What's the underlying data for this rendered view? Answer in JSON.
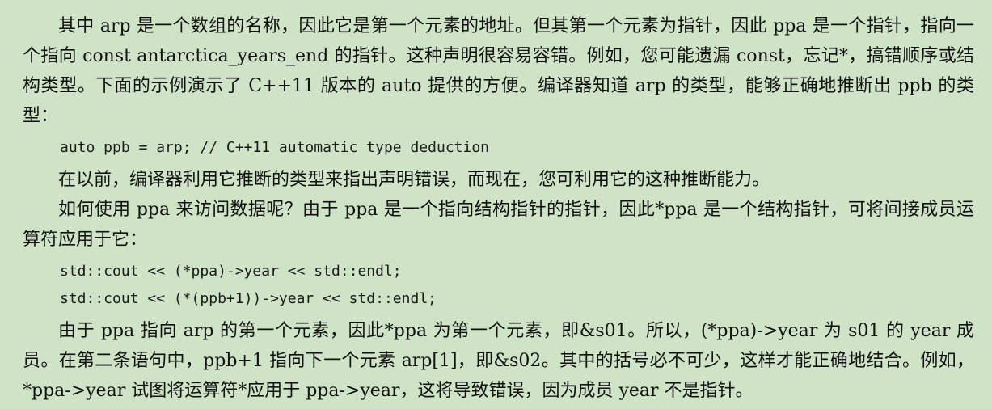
{
  "paragraphs": {
    "p1": "其中 arp 是一个数组的名称，因此它是第一个元素的地址。但其第一个元素为指针，因此 ppa 是一个指针，指向一个指向 const antarctica_years_end 的指针。这种声明很容易容错。例如，您可能遗漏 const，忘记*，搞错顺序或结构类型。下面的示例演示了 C++11 版本的 auto 提供的方便。编译器知道 arp 的类型，能够正确地推断出 ppb 的类型：",
    "code1": "auto ppb = arp; // C++11 automatic type deduction",
    "p2": "在以前，编译器利用它推断的类型来指出声明错误，而现在，您可利用它的这种推断能力。",
    "p3": "如何使用 ppa 来访问数据呢？由于 ppa 是一个指向结构指针的指针，因此*ppa 是一个结构指针，可将间接成员运算符应用于它：",
    "code2_line1": "std::cout << (*ppa)->year << std::endl;",
    "code2_line2": "std::cout << (*(ppb+1))->year << std::endl;",
    "p4": "由于 ppa 指向 arp 的第一个元素，因此*ppa 为第一个元素，即&s01。所以，(*ppa)->year 为 s01 的 year 成员。在第二条语句中，ppb+1 指向下一个元素 arp[1]，即&s02。其中的括号必不可少，这样才能正确地结合。例如，*ppa->year 试图将运算符*应用于 ppa->year，这将导致错误，因为成员 year 不是指针。"
  }
}
